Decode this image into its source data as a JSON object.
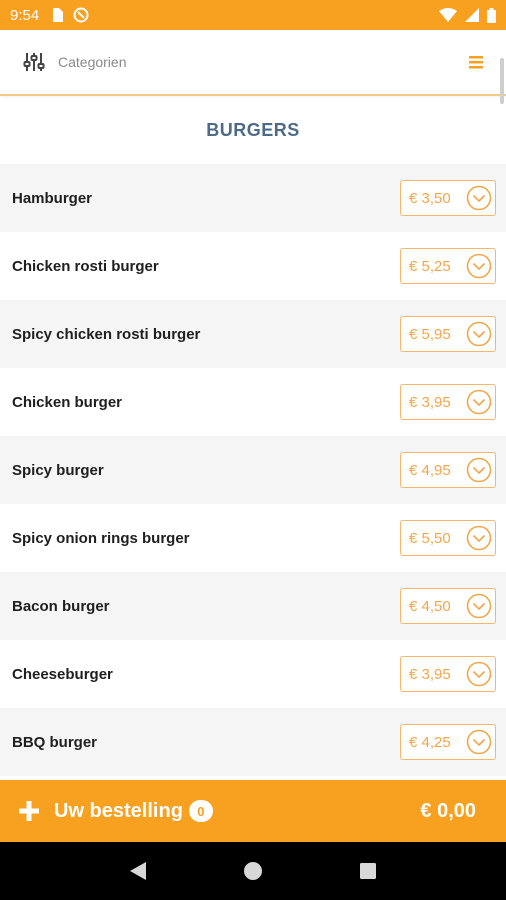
{
  "status_bar": {
    "time": "9:54"
  },
  "header": {
    "category_label": "Categorien"
  },
  "section": {
    "title": "BURGERS"
  },
  "products": [
    {
      "name": "Hamburger",
      "price": "€ 3,50"
    },
    {
      "name": "Chicken rosti burger",
      "price": "€ 5,25"
    },
    {
      "name": "Spicy chicken rosti burger",
      "price": "€ 5,95"
    },
    {
      "name": "Chicken burger",
      "price": "€ 3,95"
    },
    {
      "name": "Spicy burger",
      "price": "€ 4,95"
    },
    {
      "name": "Spicy onion rings burger",
      "price": "€ 5,50"
    },
    {
      "name": "Bacon burger",
      "price": "€ 4,50"
    },
    {
      "name": "Cheeseburger",
      "price": "€ 3,95"
    },
    {
      "name": "BBQ burger",
      "price": "€ 4,25"
    }
  ],
  "order_bar": {
    "label": "Uw bestelling",
    "count": "0",
    "total": "€ 0,00"
  },
  "colors": {
    "accent": "#f8a01f",
    "section_title": "#4d6b87",
    "price_text": "#f4a649"
  },
  "icons": {
    "filter": "sliders-icon",
    "menu": "hamburger-menu-icon",
    "expand": "chevron-down-circle-icon",
    "add": "plus-icon",
    "nav_back": "back-triangle-icon",
    "nav_home": "home-circle-icon",
    "nav_recents": "recents-square-icon"
  }
}
